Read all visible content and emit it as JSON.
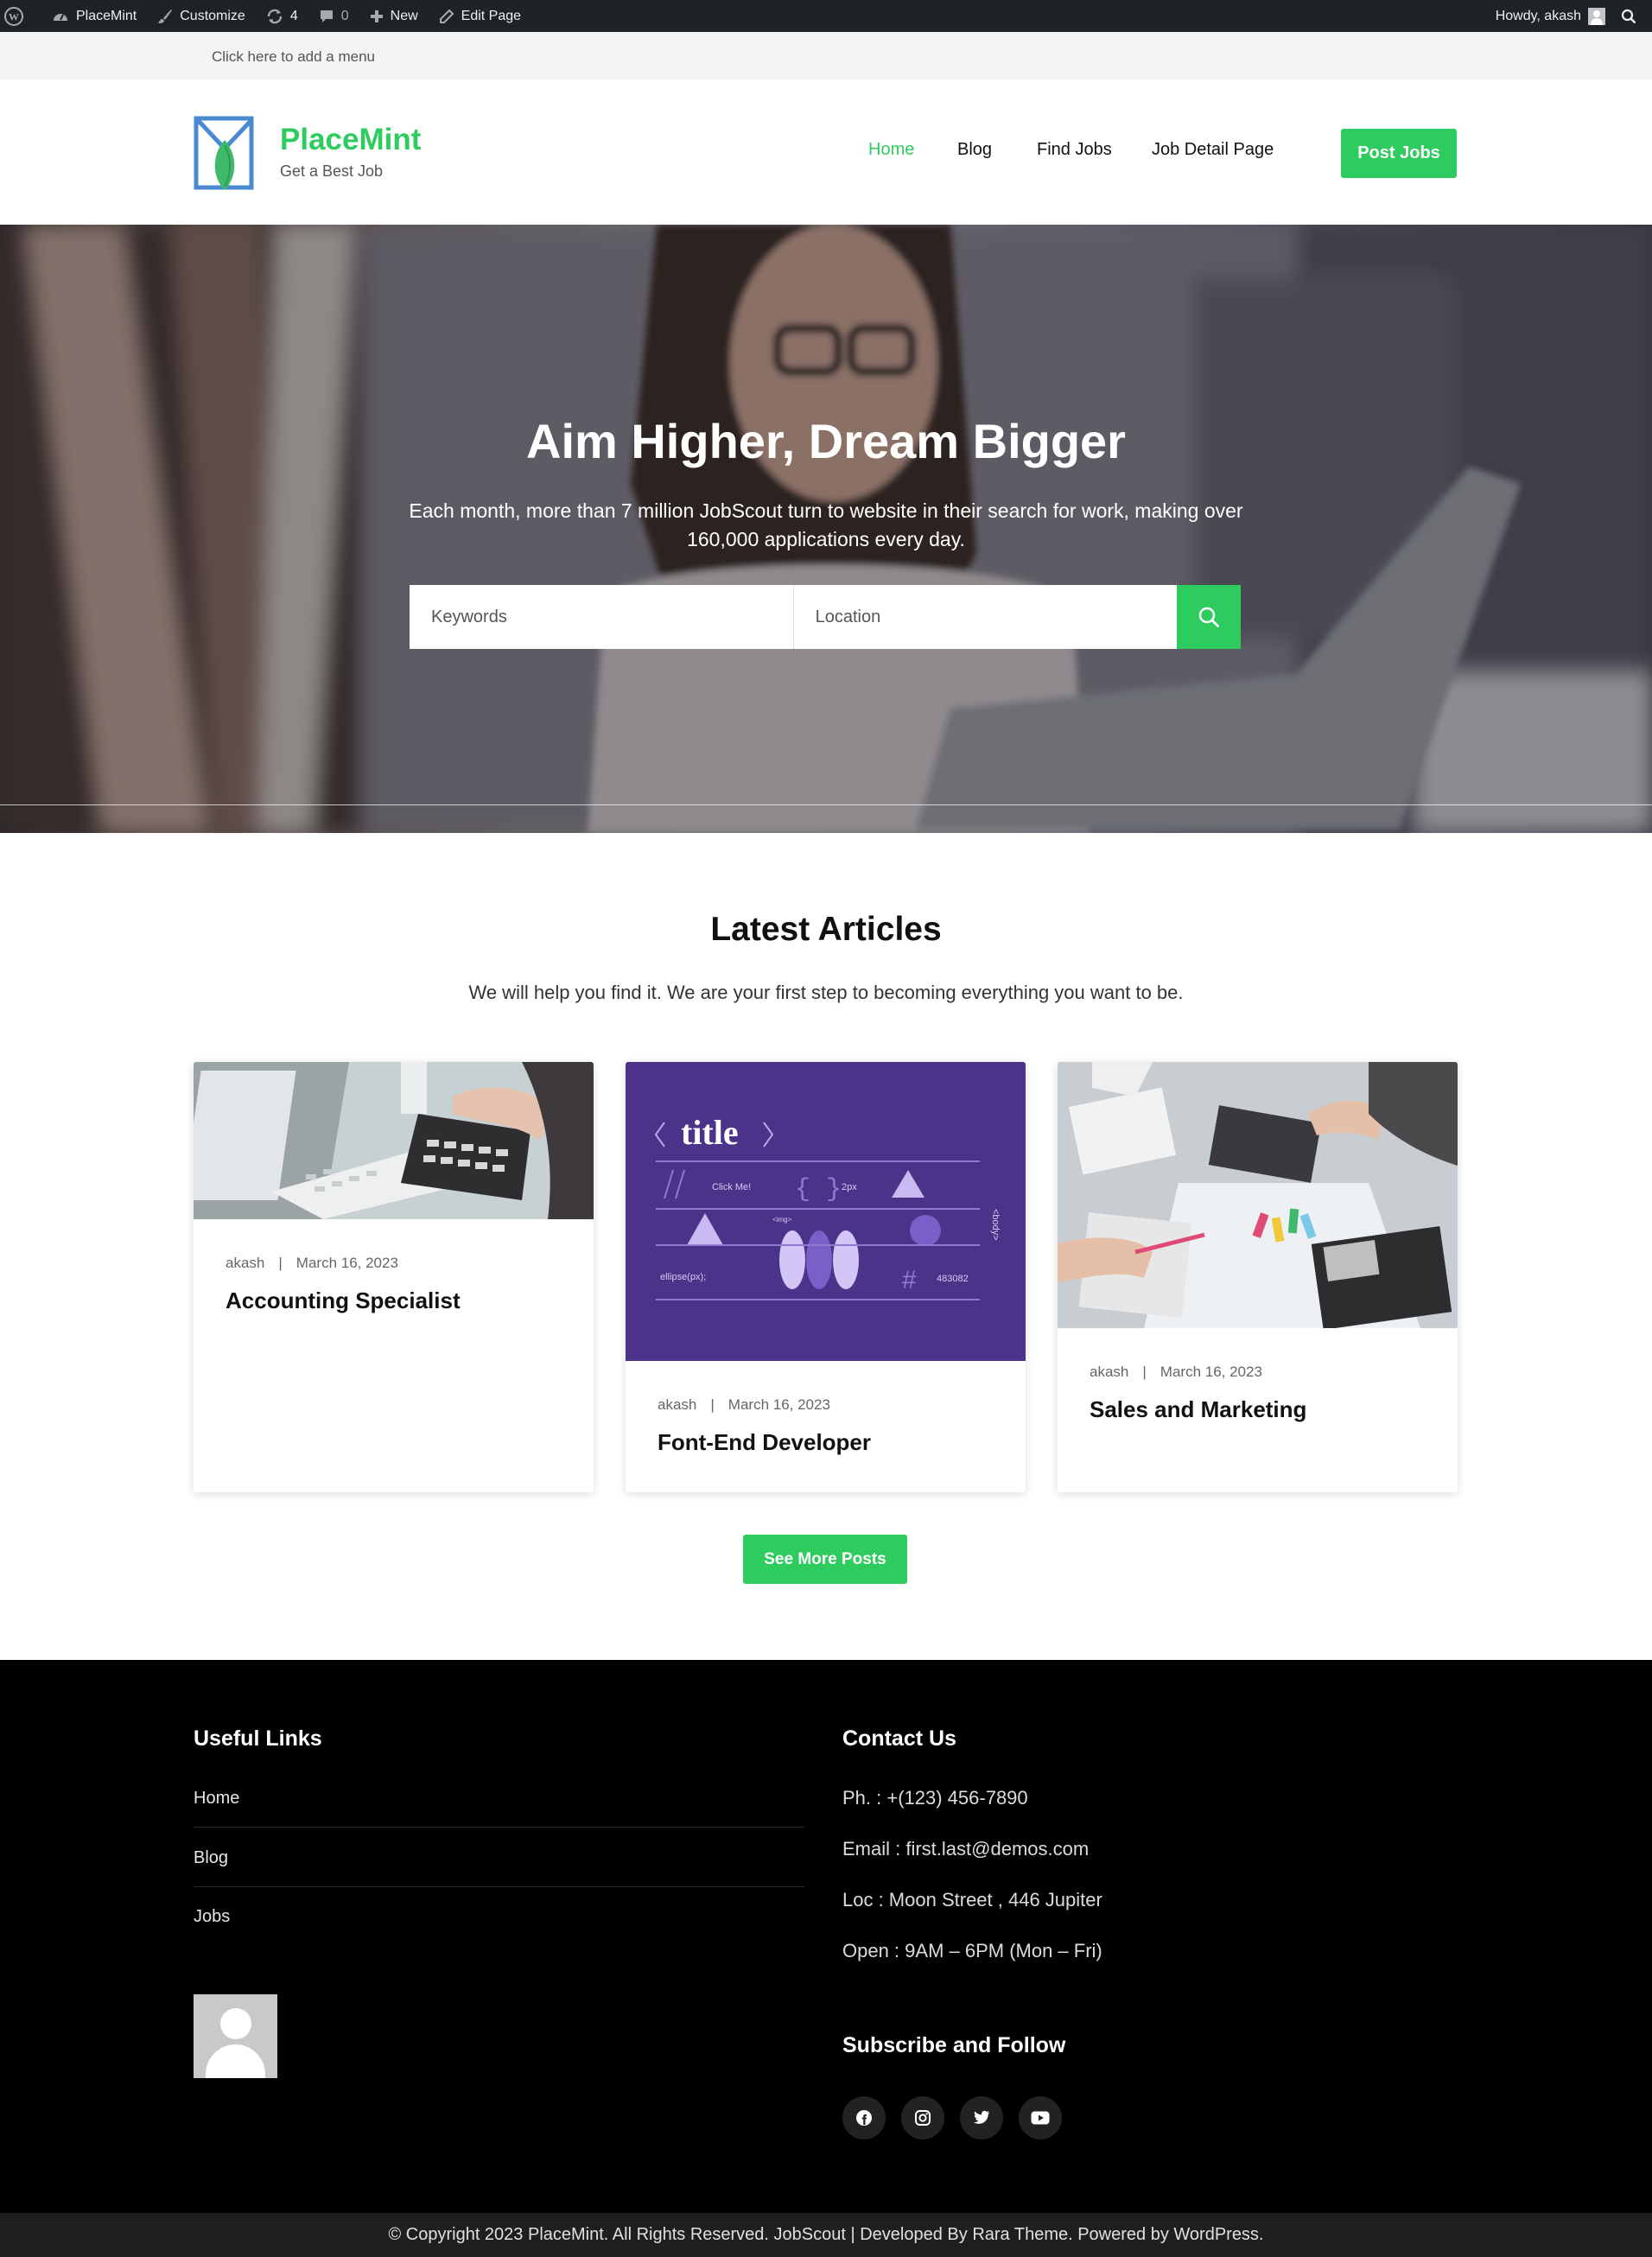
{
  "admin_bar": {
    "site": "PlaceMint",
    "customize": "Customize",
    "updates_count": "4",
    "comments_count": "0",
    "new": "New",
    "edit_page": "Edit Page",
    "howdy": "Howdy, akash"
  },
  "menu_strip": {
    "text": "Click here to add a menu"
  },
  "header": {
    "title": "PlaceMint",
    "tagline": "Get a Best Job",
    "nav": [
      {
        "label": "Home",
        "active": true
      },
      {
        "label": "Blog"
      },
      {
        "label": "Find Jobs"
      },
      {
        "label": "Job Detail Page"
      }
    ],
    "post_button": "Post Jobs"
  },
  "hero": {
    "title": "Aim Higher, Dream Bigger",
    "subtitle": "Each month, more than 7 million JobScout turn to website in their search for work, making over 160,000 applications every day.",
    "keywords_placeholder": "Keywords",
    "location_placeholder": "Location"
  },
  "articles": {
    "title": "Latest Articles",
    "subtitle": "We will help you find it. We are your first step to becoming everything you want to be.",
    "items": [
      {
        "author": "akash",
        "date": "March 16, 2023",
        "title": "Accounting Specialist"
      },
      {
        "author": "akash",
        "date": "March 16, 2023",
        "title": "Font-End Developer"
      },
      {
        "author": "akash",
        "date": "March 16, 2023",
        "title": "Sales and Marketing"
      }
    ],
    "graphic_text": {
      "title": "title",
      "click_me": "Click Me!",
      "px": "2px",
      "img": "<img>",
      "ellipse": "ellipse(px);",
      "hex": "483082",
      "body": "<body>"
    },
    "more_button": "See More Posts"
  },
  "footer": {
    "links_title": "Useful Links",
    "links": [
      "Home",
      "Blog",
      "Jobs"
    ],
    "contact_title": "Contact Us",
    "contact": [
      "Ph. : +(123) 456-7890",
      "Email : first.last@demos.com",
      "Loc : Moon Street , 446 Jupiter",
      "Open : 9AM – 6PM (Mon – Fri)"
    ],
    "subscribe_title": "Subscribe and Follow",
    "social": [
      "facebook-icon",
      "instagram-icon",
      "twitter-icon",
      "youtube-icon"
    ],
    "copyright": "© Copyright 2023 PlaceMint. All Rights Reserved. JobScout | Developed By Rara Theme. Powered by WordPress."
  },
  "colors": {
    "accent": "#2ecc5f",
    "admin_bar": "#1d2327",
    "footer": "#000000",
    "card_purple": "#4a3389"
  }
}
